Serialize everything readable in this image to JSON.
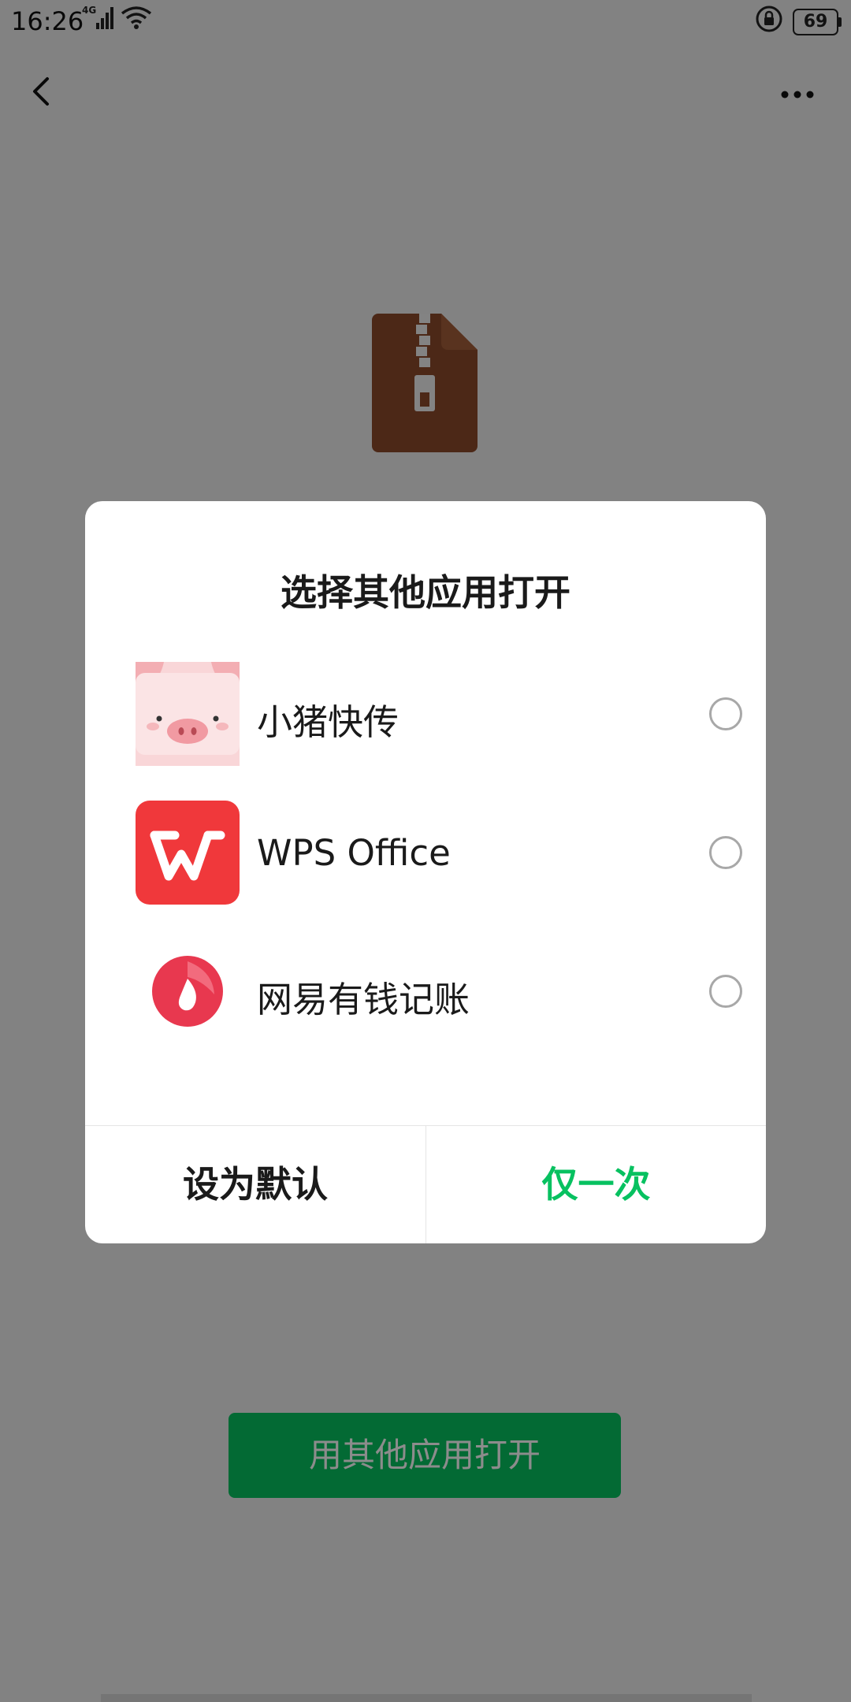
{
  "status_bar": {
    "time": "16:26",
    "network": "4G",
    "battery": "69"
  },
  "background_page": {
    "file_icon": "zip-file-icon",
    "open_button_label": "用其他应用打开",
    "accent_color": "#07c160"
  },
  "dialog": {
    "title": "选择其他应用打开",
    "apps": [
      {
        "label": "小猪快传",
        "icon": "pig-icon",
        "selected": false
      },
      {
        "label": "WPS Office",
        "icon": "wps-icon",
        "selected": false
      },
      {
        "label": "网易有钱记账",
        "icon": "netease-money-icon",
        "selected": false
      }
    ],
    "buttons": {
      "set_default": "设为默认",
      "just_once": "仅一次"
    }
  },
  "colors": {
    "accent": "#07c160",
    "wps_red": "#f0383b",
    "netease_red": "#e8384f",
    "pig_pink": "#f9d6d8"
  }
}
